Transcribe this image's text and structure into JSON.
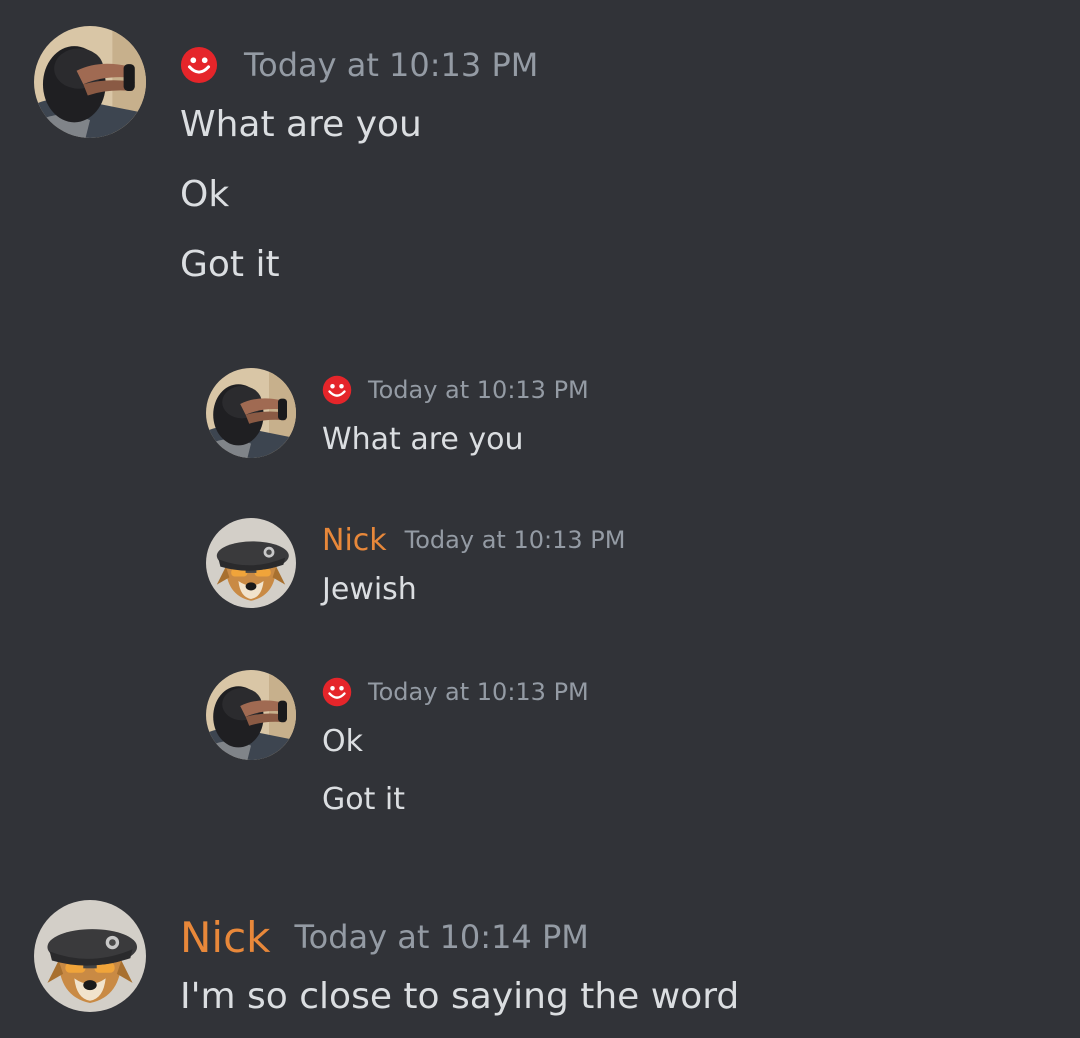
{
  "colors": {
    "background": "#313338",
    "text": "#dbdee1",
    "timestamp": "#949ba4",
    "username_nick": "#e8883a",
    "status_icon": "#e5252a"
  },
  "messages": [
    {
      "author_icon": "red-smiley-icon",
      "timestamp": "Today at 10:13 PM",
      "lines": [
        "What are you",
        "Ok",
        "Got it"
      ]
    },
    {
      "author": "Nick",
      "timestamp": "Today at 10:14 PM",
      "lines": [
        "I'm so close to saying the word"
      ]
    }
  ],
  "quoted_screenshot": {
    "messages": [
      {
        "author_icon": "red-smiley-icon",
        "timestamp": "Today at 10:13 PM",
        "lines": [
          "What are you"
        ]
      },
      {
        "author": "Nick",
        "timestamp": "Today at 10:13 PM",
        "lines": [
          "Jewish"
        ]
      },
      {
        "author_icon": "red-smiley-icon",
        "timestamp": "Today at 10:13 PM",
        "lines": [
          "Ok",
          "Got it"
        ]
      }
    ]
  }
}
